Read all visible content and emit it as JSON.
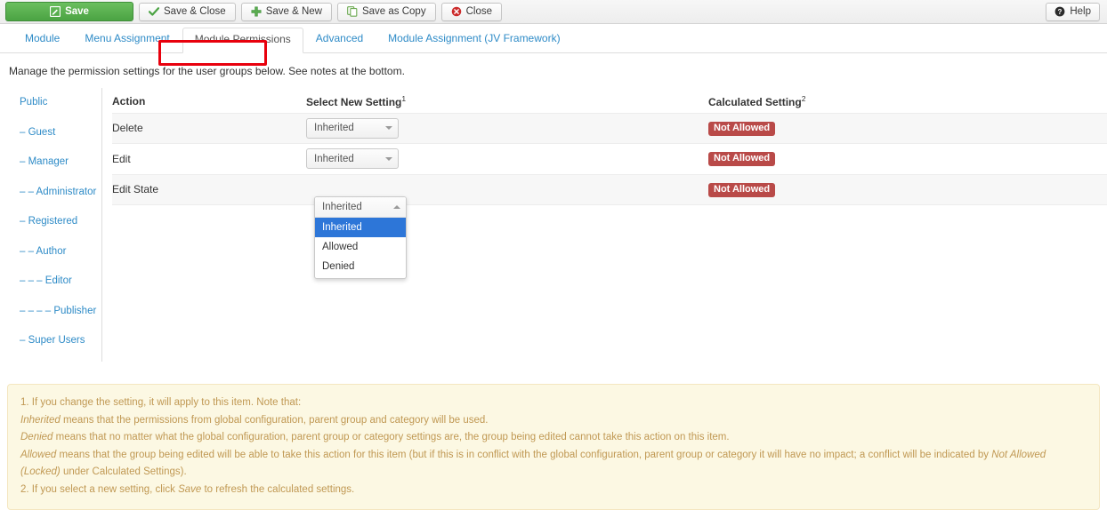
{
  "toolbar": {
    "buttons": [
      {
        "label": "Save",
        "icon": "pencil-square-icon",
        "style": "save"
      },
      {
        "label": "Save & Close",
        "icon": "check-icon",
        "style": "plain"
      },
      {
        "label": "Save & New",
        "icon": "plus-icon",
        "style": "plain"
      },
      {
        "label": "Save as Copy",
        "icon": "copy-icon",
        "style": "plain"
      },
      {
        "label": "Close",
        "icon": "close-circle-icon",
        "style": "plain"
      }
    ],
    "help": {
      "label": "Help",
      "icon": "help-circle-icon"
    }
  },
  "tabs": [
    {
      "label": "Module",
      "active": false
    },
    {
      "label": "Menu Assignment",
      "active": false
    },
    {
      "label": "Module Permissions",
      "active": true
    },
    {
      "label": "Advanced",
      "active": false
    },
    {
      "label": "Module Assignment (JV Framework)",
      "active": false
    }
  ],
  "intro": "Manage the permission settings for the user groups below. See notes at the bottom.",
  "groups": [
    {
      "label": "Public",
      "selected": true
    },
    {
      "label": "– Guest",
      "selected": false
    },
    {
      "label": "– Manager",
      "selected": false
    },
    {
      "label": "– – Administrator",
      "selected": false
    },
    {
      "label": "– Registered",
      "selected": false
    },
    {
      "label": "– – Author",
      "selected": false
    },
    {
      "label": "– – – Editor",
      "selected": false
    },
    {
      "label": "– – – – Publisher",
      "selected": false
    },
    {
      "label": "– Super Users",
      "selected": false
    }
  ],
  "table": {
    "headers": {
      "action": "Action",
      "select": "Select New Setting",
      "select_note": "1",
      "calculated": "Calculated Setting",
      "calculated_note": "2"
    },
    "rows": [
      {
        "action": "Delete",
        "setting": "Inherited",
        "calculated": "Not Allowed",
        "open": false
      },
      {
        "action": "Edit",
        "setting": "Inherited",
        "calculated": "Not Allowed",
        "open": false
      },
      {
        "action": "Edit State",
        "setting": "Inherited",
        "calculated": "Not Allowed",
        "open": true
      }
    ]
  },
  "dropdown": {
    "current": "Inherited",
    "options": [
      {
        "label": "Inherited",
        "selected": true
      },
      {
        "label": "Allowed",
        "selected": false
      },
      {
        "label": "Denied",
        "selected": false
      }
    ]
  },
  "notes": {
    "line1": "1. If you change the setting, it will apply to this item. Note that:",
    "line2_em": "Inherited",
    "line2": " means that the permissions from global configuration, parent group and category will be used.",
    "line3_em": "Denied",
    "line3": " means that no matter what the global configuration, parent group or category settings are, the group being edited cannot take this action on this item.",
    "line4_em": "Allowed",
    "line4a": " means that the group being edited will be able to take this action for this item (but if this is in conflict with the global configuration, parent group or category it will have no impact; a conflict will be indicated by ",
    "line4_em2": "Not Allowed (Locked)",
    "line4b": " under Calculated Settings).",
    "line5a": "2. If you select a new setting, click ",
    "line5_em": "Save",
    "line5b": " to refresh the calculated settings."
  },
  "colors": {
    "save_green": "#4ba343",
    "tab_link": "#2e8bc7",
    "badge_red": "#b94a48",
    "annotation_red": "#e8000d",
    "notes_bg": "#fcf8e3",
    "notes_text": "#c09853",
    "dropdown_highlight": "#2d76d8"
  }
}
